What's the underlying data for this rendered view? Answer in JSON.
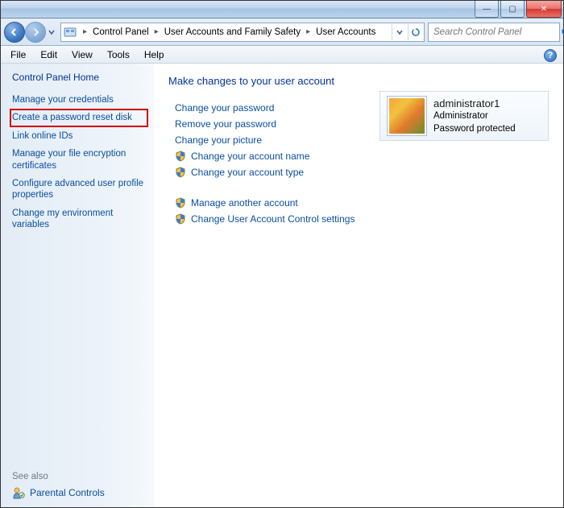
{
  "titlebar": {
    "min": "—",
    "max": "▢",
    "close": "✕"
  },
  "breadcrumb": {
    "items": [
      "Control Panel",
      "User Accounts and Family Safety",
      "User Accounts"
    ]
  },
  "search": {
    "placeholder": "Search Control Panel"
  },
  "menu": {
    "items": [
      "File",
      "Edit",
      "View",
      "Tools",
      "Help"
    ]
  },
  "sidebar": {
    "home": "Control Panel Home",
    "links": [
      "Manage your credentials",
      "Create a password reset disk",
      "Link online IDs",
      "Manage your file encryption certificates",
      "Configure advanced user profile properties",
      "Change my environment variables"
    ],
    "highlight_index": 1,
    "see_also": "See also",
    "parental": "Parental Controls"
  },
  "content": {
    "heading": "Make changes to your user account",
    "group1": [
      {
        "label": "Change your password",
        "shield": false
      },
      {
        "label": "Remove your password",
        "shield": false
      },
      {
        "label": "Change your picture",
        "shield": false
      },
      {
        "label": "Change your account name",
        "shield": true
      },
      {
        "label": "Change your account type",
        "shield": true
      }
    ],
    "group2": [
      {
        "label": "Manage another account",
        "shield": true
      },
      {
        "label": "Change User Account Control settings",
        "shield": true
      }
    ]
  },
  "account": {
    "name": "administrator1",
    "role": "Administrator",
    "status": "Password protected"
  },
  "help": "?"
}
